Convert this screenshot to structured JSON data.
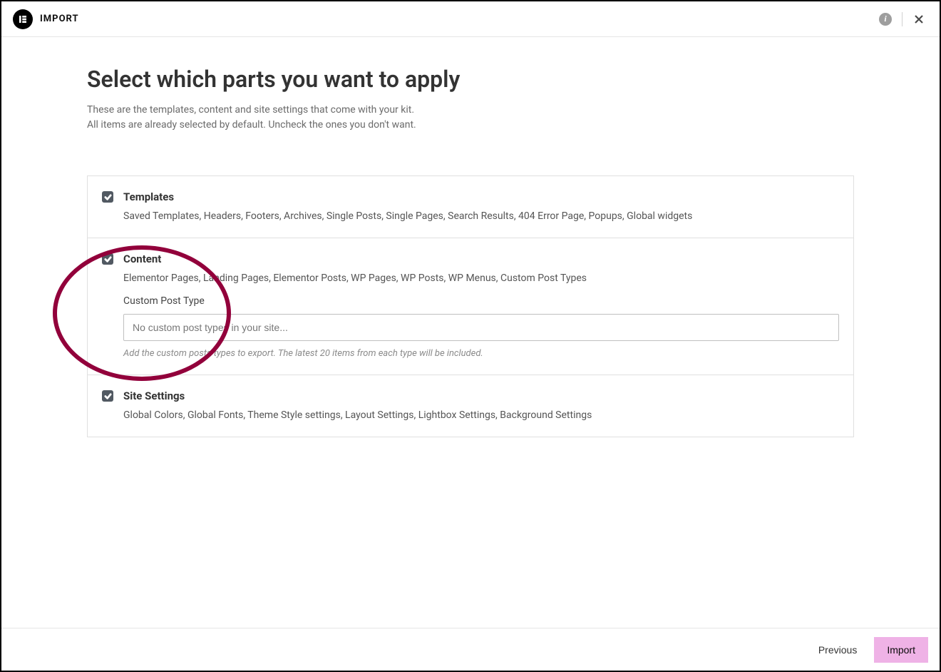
{
  "header": {
    "title": "IMPORT"
  },
  "main": {
    "heading": "Select which parts you want to apply",
    "description_line1": "These are the templates, content and site settings that come with your kit.",
    "description_line2": "All items are already selected by default. Uncheck the ones you don't want."
  },
  "sections": {
    "templates": {
      "title": "Templates",
      "sub": "Saved Templates, Headers, Footers, Archives, Single Posts, Single Pages, Search Results, 404 Error Page, Popups, Global widgets",
      "checked": true
    },
    "content": {
      "title": "Content",
      "sub": "Elementor Pages, Landing Pages, Elementor Posts, WP Pages, WP Posts, WP Menus, Custom Post Types",
      "checked": true,
      "cpt_label": "Custom Post Type",
      "cpt_placeholder": "No custom post types in your site...",
      "cpt_hint": "Add the custom posts types to export. The latest 20 items from each type will be included."
    },
    "settings": {
      "title": "Site Settings",
      "sub": "Global Colors, Global Fonts, Theme Style settings, Layout Settings, Lightbox Settings, Background Settings",
      "checked": true
    }
  },
  "footer": {
    "previous": "Previous",
    "import": "Import"
  }
}
